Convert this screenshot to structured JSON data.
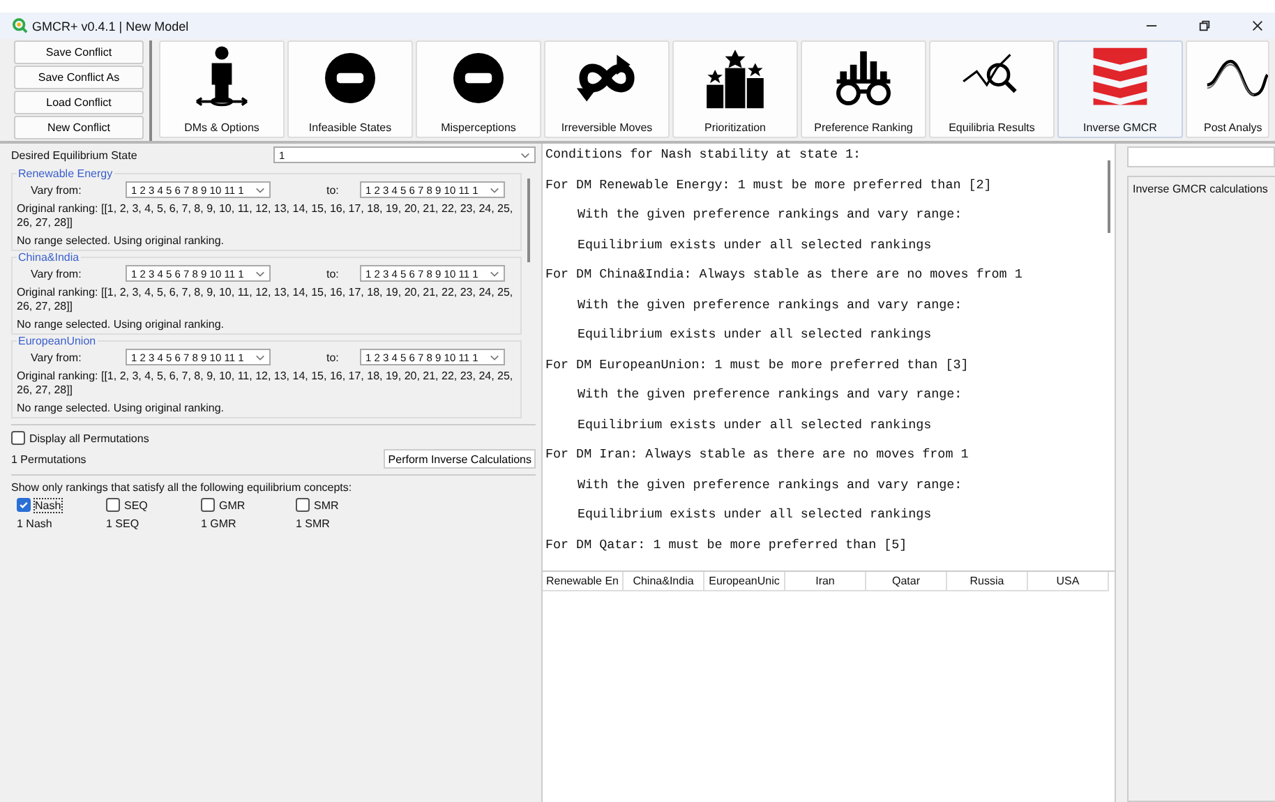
{
  "window": {
    "title": "GMCR+ v0.4.1 | New Model"
  },
  "file_buttons": [
    "Save Conflict",
    "Save Conflict As",
    "Load Conflict",
    "New Conflict"
  ],
  "toolbar": [
    {
      "label": "DMs & Options",
      "selected": false
    },
    {
      "label": "Infeasible States",
      "selected": false
    },
    {
      "label": "Misperceptions",
      "selected": false
    },
    {
      "label": "Irreversible Moves",
      "selected": false
    },
    {
      "label": "Prioritization",
      "selected": false
    },
    {
      "label": "Preference Ranking",
      "selected": false
    },
    {
      "label": "Equilibria Results",
      "selected": false
    },
    {
      "label": "Inverse GMCR",
      "selected": true
    },
    {
      "label": "Post Analys",
      "selected": false
    }
  ],
  "desired_state": {
    "label": "Desired Equilibrium State",
    "value": "1"
  },
  "dms": [
    {
      "name": "Renewable Energy",
      "from_label": "Vary from:",
      "from_value": "1 2 3 4 5 6 7 8 9 10 11 1",
      "to_label": "to:",
      "to_value": "1 2 3 4 5 6 7 8 9 10 11 1",
      "original_ranking": "Original ranking: [[1, 2, 3, 4, 5, 6, 7, 8, 9, 10, 11, 12, 13, 14, 15, 16, 17, 18, 19, 20, 21, 22, 23, 24, 25, 26, 27, 28]]",
      "note": "No range selected. Using original ranking."
    },
    {
      "name": "China&India",
      "from_label": "Vary from:",
      "from_value": "1 2 3 4 5 6 7 8 9 10 11 1",
      "to_label": "to:",
      "to_value": "1 2 3 4 5 6 7 8 9 10 11 1",
      "original_ranking": "Original ranking: [[1, 2, 3, 4, 5, 6, 7, 8, 9, 10, 11, 12, 13, 14, 15, 16, 17, 18, 19, 20, 21, 22, 23, 24, 25, 26, 27, 28]]",
      "note": "No range selected. Using original ranking."
    },
    {
      "name": "EuropeanUnion",
      "from_label": "Vary from:",
      "from_value": "1 2 3 4 5 6 7 8 9 10 11 1",
      "to_label": "to:",
      "to_value": "1 2 3 4 5 6 7 8 9 10 11 1",
      "original_ranking": "Original ranking: [[1, 2, 3, 4, 5, 6, 7, 8, 9, 10, 11, 12, 13, 14, 15, 16, 17, 18, 19, 20, 21, 22, 23, 24, 25, 26, 27, 28]]",
      "note": "No range selected. Using original ranking."
    }
  ],
  "display_all": {
    "label": "Display all Permutations",
    "checked": false
  },
  "permutations": "1 Permutations",
  "perform_button": "Perform Inverse Calculations",
  "filter_label": "Show only rankings that satisfy all the following equilibrium concepts:",
  "concepts": [
    {
      "label": "Nash",
      "checked": true,
      "count": "1 Nash"
    },
    {
      "label": "SEQ",
      "checked": false,
      "count": "1 SEQ"
    },
    {
      "label": "GMR",
      "checked": false,
      "count": "1 GMR"
    },
    {
      "label": "SMR",
      "checked": false,
      "count": "1 SMR"
    }
  ],
  "output_lines": [
    {
      "kind": "head",
      "text": "Conditions for Nash stability at state 1:"
    },
    {
      "kind": "head",
      "text": "For DM Renewable Energy: 1 must be more preferred than [2]"
    },
    {
      "kind": "detail",
      "text": "With the given preference rankings and vary range:"
    },
    {
      "kind": "detail",
      "text": "Equilibrium exists under all selected rankings"
    },
    {
      "kind": "head",
      "text": "For DM China&India: Always stable as there are no moves from 1"
    },
    {
      "kind": "detail",
      "text": "With the given preference rankings and vary range:"
    },
    {
      "kind": "detail",
      "text": "Equilibrium exists under all selected rankings"
    },
    {
      "kind": "head",
      "text": "For DM EuropeanUnion: 1 must be more preferred than [3]"
    },
    {
      "kind": "detail",
      "text": "With the given preference rankings and vary range:"
    },
    {
      "kind": "detail",
      "text": "Equilibrium exists under all selected rankings"
    },
    {
      "kind": "head",
      "text": "For DM Iran: Always stable as there are no moves from 1"
    },
    {
      "kind": "detail",
      "text": "With the given preference rankings and vary range:"
    },
    {
      "kind": "detail",
      "text": "Equilibrium exists under all selected rankings"
    },
    {
      "kind": "head",
      "text": "For DM Qatar: 1 must be more preferred than [5]"
    }
  ],
  "table_columns": [
    "Renewable En",
    "China&India",
    "EuropeanUnic",
    "Iran",
    "Qatar",
    "Russia",
    "USA"
  ],
  "right_panel": {
    "label": "Inverse GMCR calculations"
  }
}
